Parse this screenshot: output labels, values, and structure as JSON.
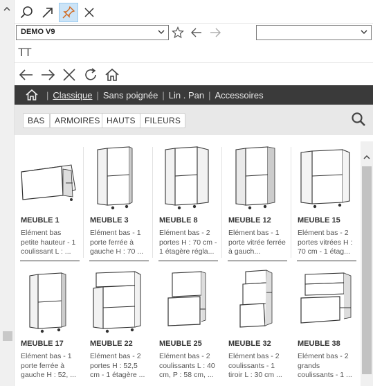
{
  "toolbar": {
    "icons": [
      "search-icon",
      "arrow-up-right-icon",
      "pin-icon",
      "close-icon"
    ]
  },
  "row2": {
    "project_select": "DEMO V9",
    "second_select": ""
  },
  "tt_label": "TT",
  "menu": {
    "items": [
      "Classique",
      "Sans poignée",
      "Lin . Pan",
      "Accessoires"
    ]
  },
  "filters": [
    "BAS",
    "ARMOIRES",
    "HAUTS",
    "FILEURS"
  ],
  "products": [
    {
      "name": "MEUBLE 1",
      "desc": "Elément bas petite hauteur - 1 coulissant L : ..."
    },
    {
      "name": "MEUBLE 3",
      "desc": "Elément bas - 1 porte ferrée à gauche H : 70 ..."
    },
    {
      "name": "MEUBLE 8",
      "desc": "Elément bas - 2 portes H : 70 cm - 1 étagère régla..."
    },
    {
      "name": "MEUBLE 12",
      "desc": "Elément bas - 1 porte vitrée ferrée à gauch..."
    },
    {
      "name": "MEUBLE 15",
      "desc": "Elément bas - 2 portes vitrées H : 70 cm - 1 étag..."
    },
    {
      "name": "MEUBLE 17",
      "desc": "Elément bas - 1 porte ferrée à gauche H : 52, ..."
    },
    {
      "name": "MEUBLE 22",
      "desc": "Elément bas - 2 portes H : 52,5 cm - 1 étagère ..."
    },
    {
      "name": "MEUBLE 25",
      "desc": "Elément bas - 2 coulissants L : 40 cm, P : 58 cm, ..."
    },
    {
      "name": "MEUBLE 32",
      "desc": "Elément bas - 2 coulissants - 1 tiroir L : 30 cm ..."
    },
    {
      "name": "MEUBLE 38",
      "desc": "Elément bas - 2 grands coulissants - 1 ..."
    }
  ]
}
